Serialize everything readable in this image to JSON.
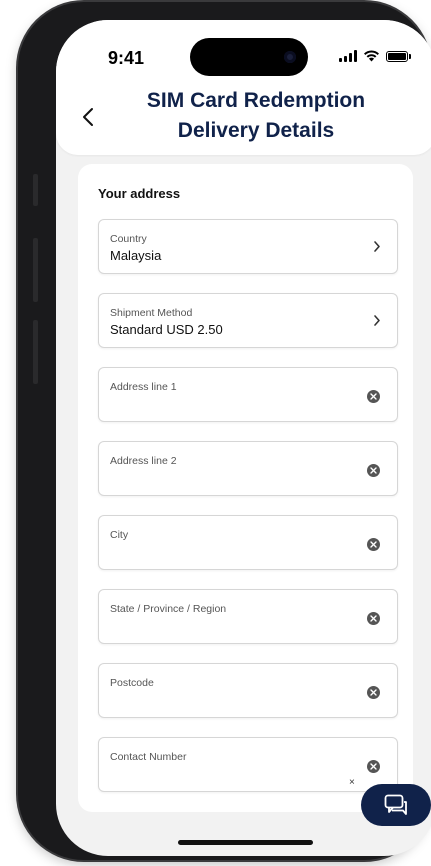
{
  "status_bar": {
    "time": "9:41"
  },
  "header": {
    "title_line1": "SIM Card Redemption",
    "title_line2": "Delivery Details"
  },
  "form": {
    "section_title": "Your address",
    "country": {
      "label": "Country",
      "value": "Malaysia"
    },
    "shipment": {
      "label": "Shipment Method",
      "value": "Standard USD 2.50"
    },
    "address1": {
      "label": "Address line 1",
      "value": ""
    },
    "address2": {
      "label": "Address line 2",
      "value": ""
    },
    "city": {
      "label": "City",
      "value": ""
    },
    "state": {
      "label": "State / Province / Region",
      "value": ""
    },
    "postcode": {
      "label": "Postcode",
      "value": ""
    },
    "contact": {
      "label": "Contact Number",
      "value": ""
    },
    "stray_close": "×"
  },
  "icons": {
    "back": "chevron-left-icon",
    "chevron": "chevron-right-icon",
    "clear": "clear-icon",
    "chat": "chat-icon"
  },
  "colors": {
    "brand_navy": "#10224a",
    "screen_bg": "#f2f2f2",
    "field_border": "#d6d6d6"
  }
}
